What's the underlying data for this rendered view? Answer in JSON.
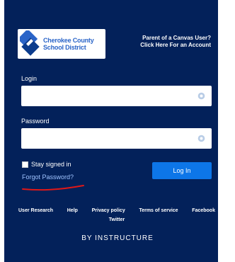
{
  "logo": {
    "line1": "Cherokee County",
    "line2": "School District"
  },
  "parent_link": {
    "line1": "Parent of a Canvas User?",
    "line2": "Click Here For an Account"
  },
  "login": {
    "label": "Login",
    "value": ""
  },
  "password": {
    "label": "Password",
    "value": ""
  },
  "stay_signed_in": "Stay signed in",
  "forgot_password": "Forgot Password?",
  "login_button": "Log In",
  "footer": {
    "links": [
      "User Research",
      "Help",
      "Privacy policy",
      "Terms of service",
      "Facebook"
    ],
    "twitter": "Twitter"
  },
  "brand": "BY INSTRUCTURE",
  "colors": {
    "panel": "#03215a",
    "button": "#0d76e8",
    "logo_blue": "#2a64c8",
    "underline": "#e01818"
  },
  "icons": {
    "logo": "cherokee-county-logo-icon",
    "field": "keyboard-icon"
  }
}
